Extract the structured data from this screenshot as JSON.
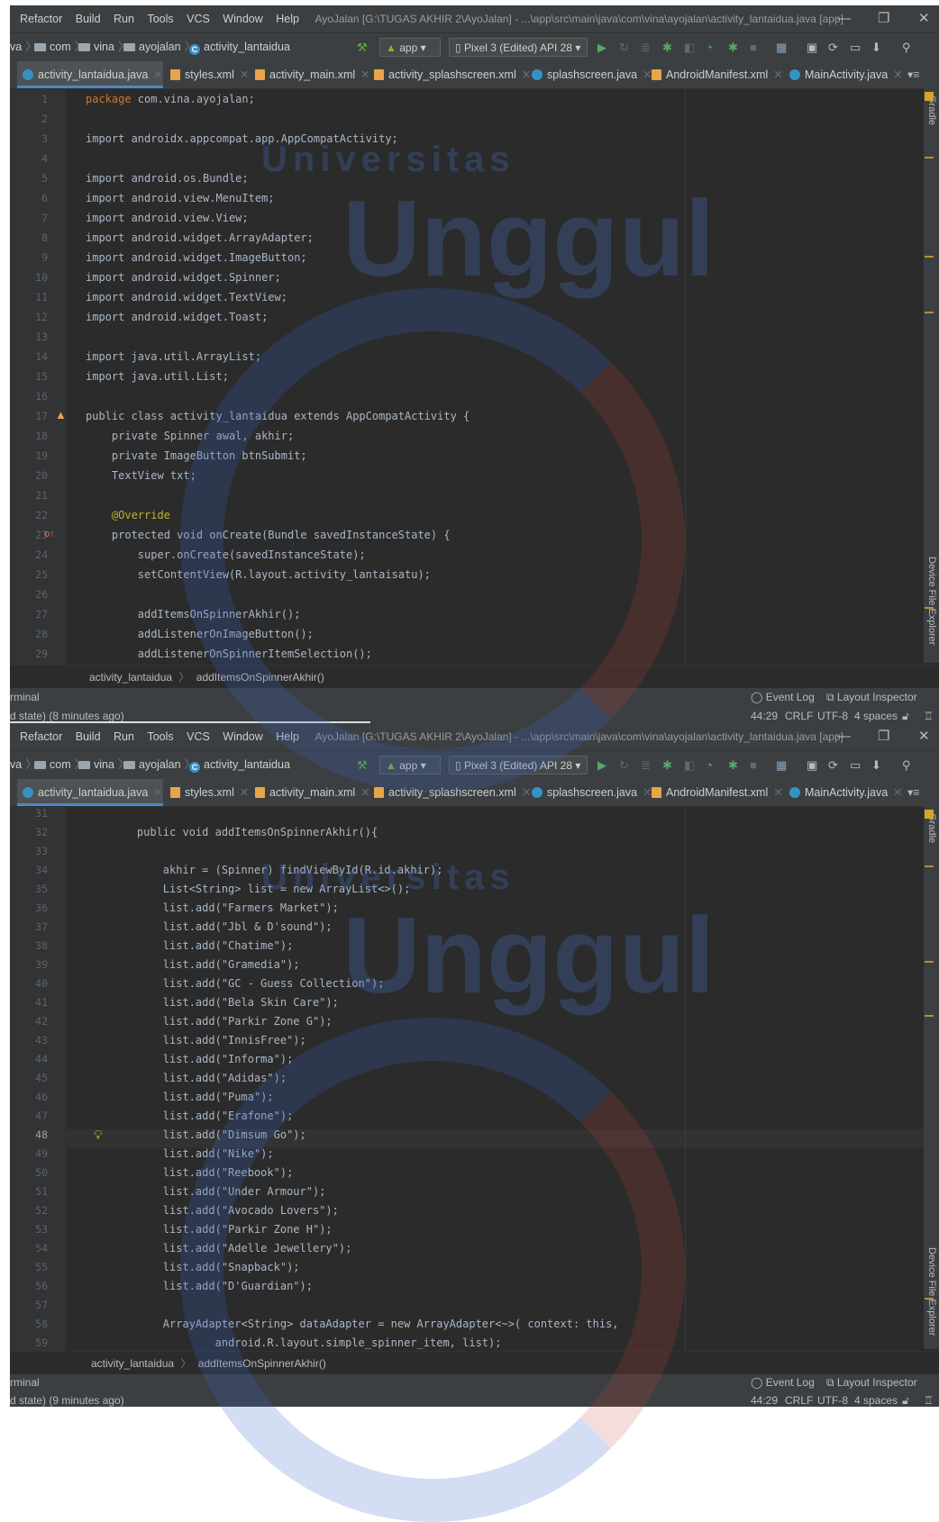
{
  "menu": [
    "Refactor",
    "Build",
    "Run",
    "Tools",
    "VCS",
    "Window",
    "Help"
  ],
  "window_path": "AyoJalan [G:\\TUGAS AKHIR 2\\AyoJalan] - ...\\app\\src\\main\\java\\com\\vina\\ayojalan\\activity_lantaidua.java [app]",
  "window_controls": {
    "minimize": "—",
    "restore": "❐",
    "close": "✕"
  },
  "breadcrumbs": [
    "va",
    "com",
    "vina",
    "ayojalan",
    "activity_lantaidua"
  ],
  "run_config": "app",
  "device": "Pixel 3 (Edited) API 28",
  "tabs": [
    "activity_lantaidua.java",
    "styles.xml",
    "activity_main.xml",
    "activity_splashscreen.xml",
    "splashscreen.java",
    "AndroidManifest.xml",
    "MainActivity.java"
  ],
  "side_tabs": {
    "gradle": "Gradle",
    "device_explorer": "Device File Explorer"
  },
  "watermark": {
    "line1": "Universitas",
    "line2": "Unggul"
  },
  "panel1": {
    "line_numbers": [
      "1",
      "2",
      "3",
      "4",
      "5",
      "6",
      "7",
      "8",
      "9",
      "10",
      "11",
      "12",
      "13",
      "14",
      "15",
      "16",
      "17",
      "18",
      "19",
      "20",
      "21",
      "22",
      "23",
      "24",
      "25",
      "26",
      "27",
      "28",
      "29"
    ],
    "code": [
      "package com.vina.ayojalan;",
      "",
      "import androidx.appcompat.app.AppCompatActivity;",
      "",
      "import android.os.Bundle;",
      "import android.view.MenuItem;",
      "import android.view.View;",
      "import android.widget.ArrayAdapter;",
      "import android.widget.ImageButton;",
      "import android.widget.Spinner;",
      "import android.widget.TextView;",
      "import android.widget.Toast;",
      "",
      "import java.util.ArrayList;",
      "import java.util.List;",
      "",
      "public class activity_lantaidua extends AppCompatActivity {",
      "    private Spinner awal, akhir;",
      "    private ImageButton btnSubmit;",
      "    TextView txt;",
      "",
      "    @Override",
      "    protected void onCreate(Bundle savedInstanceState) {",
      "        super.onCreate(savedInstanceState);",
      "        setContentView(R.layout.activity_lantaisatu);",
      "",
      "        addItemsOnSpinnerAkhir();",
      "        addListenerOnImageButton();",
      "        addListenerOnSpinnerItemSelection();"
    ],
    "breadcrumb": [
      "activity_lantaidua",
      "addItemsOnSpinnerAkhir()"
    ],
    "status_left_1": "rminal",
    "status_left_2": "d state) (8 minutes ago)"
  },
  "panel2": {
    "line_numbers": [
      "31",
      "32",
      "33",
      "34",
      "35",
      "36",
      "37",
      "38",
      "39",
      "40",
      "41",
      "42",
      "43",
      "44",
      "45",
      "46",
      "47",
      "48",
      "49",
      "50",
      "51",
      "52",
      "53",
      "54",
      "55",
      "56",
      "57",
      "58",
      "59"
    ],
    "code": [
      "",
      "    public void addItemsOnSpinnerAkhir(){",
      "",
      "        akhir = (Spinner) findViewById(R.id.akhir);",
      "        List<String> list = new ArrayList<>();",
      "        list.add(\"Farmers Market\");",
      "        list.add(\"Jbl & D'sound\");",
      "        list.add(\"Chatime\");",
      "        list.add(\"Gramedia\");",
      "        list.add(\"GC - Guess Collection\");",
      "        list.add(\"Bela Skin Care\");",
      "        list.add(\"Parkir Zone G\");",
      "        list.add(\"InnisFree\");",
      "        list.add(\"Informa\");",
      "        list.add(\"Adidas\");",
      "        list.add(\"Puma\");",
      "        list.add(\"Erafone\");",
      "        list.add(\"Dimsum Go\");",
      "        list.add(\"Nike\");",
      "        list.add(\"Reebook\");",
      "        list.add(\"Under Armour\");",
      "        list.add(\"Avocado Lovers\");",
      "        list.add(\"Parkir Zone H\");",
      "        list.add(\"Adelle Jewellery\");",
      "        list.add(\"Snapback\");",
      "        list.add(\"D'Guardian\");",
      "",
      "        ArrayAdapter<String> dataAdapter = new ArrayAdapter<~>( context: this,",
      "                android.R.layout.simple_spinner_item, list);"
    ],
    "breadcrumb": [
      "activity_lantaidua",
      "addItemsOnSpinnerAkhir()"
    ],
    "status_left_1": "rminal",
    "status_left_2": "d state) (9 minutes ago)"
  },
  "status_right": {
    "event_log": "Event Log",
    "layout_inspector": "Layout Inspector",
    "position": "44:29",
    "line_sep": "CRLF",
    "encoding": "UTF-8",
    "indent": "4 spaces"
  },
  "colors": {
    "bg": "#2b2b2b",
    "chrome": "#3c3f41",
    "keyword": "#cc7832",
    "string": "#6a8759",
    "annotation": "#bbb529",
    "function": "#ffc66d",
    "field": "#9876aa"
  }
}
